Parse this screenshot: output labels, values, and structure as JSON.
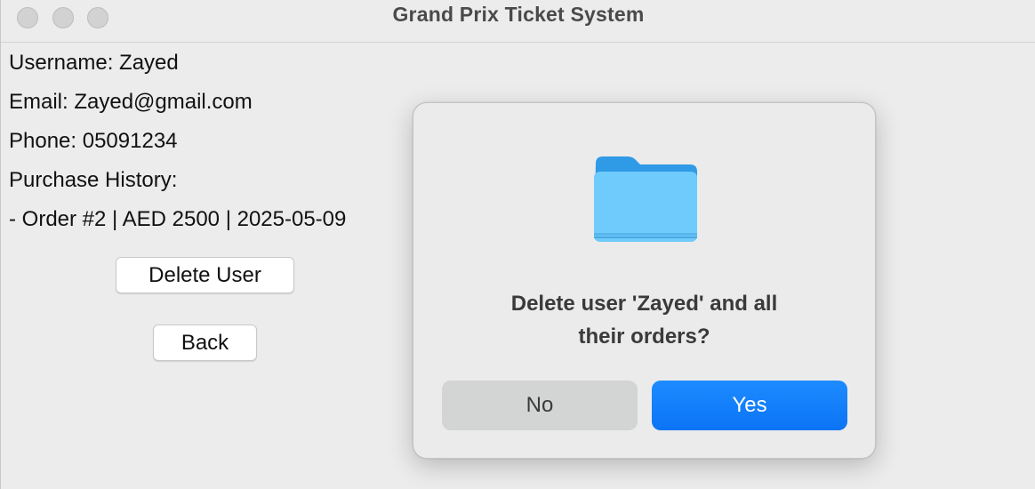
{
  "window": {
    "title": "Grand Prix Ticket System"
  },
  "user_info": {
    "username_line": "Username: Zayed",
    "email_line": "Email: Zayed@gmail.com",
    "phone_line": "Phone: 05091234",
    "purchase_history_label": "Purchase History:",
    "orders": [
      "- Order #2 | AED 2500 | 2025-05-09"
    ]
  },
  "buttons": {
    "delete_user": "Delete User",
    "back": "Back"
  },
  "dialog": {
    "icon": "folder-icon",
    "message_line1": "Delete user 'Zayed' and all",
    "message_line2": "their orders?",
    "no_label": "No",
    "yes_label": "Yes"
  },
  "colors": {
    "accent": "#0b74f5",
    "folder": "#6fcbfb"
  }
}
